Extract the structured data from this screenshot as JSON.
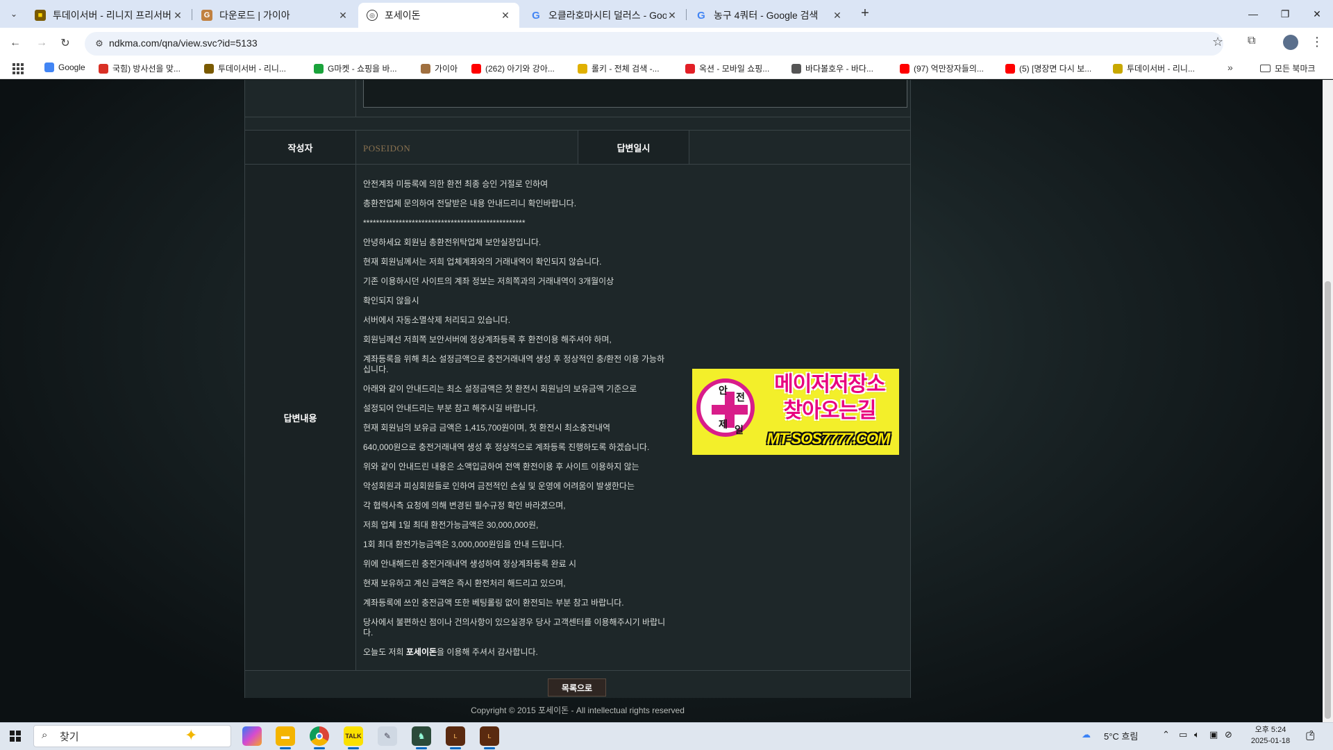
{
  "browser": {
    "tabs": [
      {
        "title": "투데이서버 - 리니지 프리서버",
        "favicon": "lineage-favicon",
        "active": false
      },
      {
        "title": "다운로드 | 가이아",
        "favicon": "gaia-favicon",
        "active": false
      },
      {
        "title": "포세이돈",
        "favicon": "globe-favicon",
        "active": true
      },
      {
        "title": "오클라호마시티 덜러스 - Goog",
        "favicon": "google-favicon",
        "active": false
      },
      {
        "title": "농구 4쿼터 - Google 검색",
        "favicon": "google-favicon",
        "active": false
      }
    ],
    "url": "ndkma.com/qna/view.svc?id=5133",
    "bookmarks": [
      {
        "label": "Google",
        "icon": "google-icon",
        "color": "#4285f4"
      },
      {
        "label": "국힘) 방사선을 맞...",
        "icon": "bookmark-site-icon",
        "color": "#d93025"
      },
      {
        "label": "투데이서버 - 리니...",
        "icon": "lineage-icon",
        "color": "#7a5a00"
      },
      {
        "label": "G마켓 - 쇼핑을 바...",
        "icon": "gmarket-icon",
        "color": "#1aa33b"
      },
      {
        "label": "가이아",
        "icon": "gaia-icon",
        "color": "#a07040"
      },
      {
        "label": "(262) 아기와 강아...",
        "icon": "youtube-icon",
        "color": "#ff0000"
      },
      {
        "label": "롤키 - 전체 검색 -...",
        "icon": "kakao-icon",
        "color": "#e0b000"
      },
      {
        "label": "옥션 - 모바일 쇼핑...",
        "icon": "auction-icon",
        "color": "#e21f26"
      },
      {
        "label": "바다볼호우 - 바다...",
        "icon": "globe-icon",
        "color": "#555555"
      },
      {
        "label": "(97) 억만장자들의...",
        "icon": "youtube-icon",
        "color": "#ff0000"
      },
      {
        "label": "(5) [명장면 다시 보...",
        "icon": "youtube-icon",
        "color": "#ff0000"
      },
      {
        "label": "투데이서버 - 리니...",
        "icon": "lineage-icon",
        "color": "#c8a800"
      }
    ],
    "all_bookmarks_label": "모든 북마크"
  },
  "board": {
    "author_label": "작성자",
    "author_value": "POSEIDON",
    "answer_date_label": "답변일시",
    "answer_date_value": "",
    "answer_content_label": "답변내용",
    "answer_lines": [
      "안전계좌 미등록에 의한 환전 최종 승인 거절로 인하여",
      "총환전업체 문의하여 전달받은 내용 안내드리니 확인바랍니다.",
      "**************************************************",
      "안녕하세요 회원님 총환전위탁업체 보안실장입니다.",
      "현재 회원님께서는 저희 업체계좌와의 거래내역이 확인되지 않습니다.",
      "기존 이용하시던 사이트의 계좌 정보는 저희쪽과의 거래내역이 3개월이상",
      "확인되지 않을시",
      "서버에서 자동소멸삭제 처리되고 있습니다.",
      "회원님께선 저희쪽 보안서버에 정상계좌등록 후 환전이용 해주셔야 하며,",
      "계좌등록을 위해 최소 설정금액으로 충전거래내역 생성 후 정상적인 충/환전 이용 가능하십니다.",
      "아래와 같이 안내드리는 최소 설정금액은 첫 환전시 회원님의 보유금액 기준으로",
      "설정되어 안내드리는 부분 참고 해주시길 바랍니다.",
      "현재 회원님의 보유금 금액은 1,415,700원이며, 첫 환전시 최소충전내역",
      "640,000원으로 충전거래내역 생성 후 정상적으로 계좌등록 진행하도록 하겠습니다.",
      "위와 같이 안내드린 내용은 소액입금하여 전액 환전이용 후 사이트 이용하지 않는",
      "악성회원과 피싱회원들로 인하여 금전적인 손실 및 운영에 어려움이 발생한다는",
      "각 협력사측 요청에 의해 변경된 필수규정 확인 바라겠으며,",
      "저희 업체 1일 최대 환전가능금액은 30,000,000원,",
      "1회 최대 환전가능금액은 3,000,000원임을 안내 드립니다.",
      "위에 안내해드린 충전거래내역 생성하여 정상계좌등록 완료 시",
      "현재 보유하고 계신 금액은 즉시 환전처리 해드리고 있으며,",
      "계좌등록에 쓰인 충전금액  또한 베팅롤링 없이  환전되는 부분 참고 바랍니다.",
      "당사에서 불편하신 점이나 건의사항이 있으실경우 당사 고객센터를 이용해주시기 바랍니다."
    ],
    "closing_prefix": "오늘도 저희 ",
    "closing_brand": "포세이돈",
    "closing_suffix": "을  이용해 주셔서 감사합니다.",
    "list_button": "목록으로",
    "copyright": "Copyright © 2015 포세이돈 - All intellectual rights reserved"
  },
  "banner": {
    "badge_chars": [
      "안",
      "전",
      "제",
      "일"
    ],
    "title_line1": "메이저저장소",
    "title_line2": "찾아오는길",
    "url": "MT-SOS7777.COM",
    "colors": {
      "background": "#f3ef2a",
      "accent": "#d81d8a"
    }
  },
  "taskbar": {
    "search_placeholder": "찾기",
    "weather": "5°C  흐림",
    "time": "오후 5:24",
    "date": "2025-01-18",
    "notification_count": "2",
    "apps": [
      "copilot-icon",
      "file-explorer-icon",
      "chrome-icon",
      "kakaotalk-icon",
      "app-icon",
      "game-icon",
      "lineage-icon",
      "lineage-icon"
    ]
  }
}
